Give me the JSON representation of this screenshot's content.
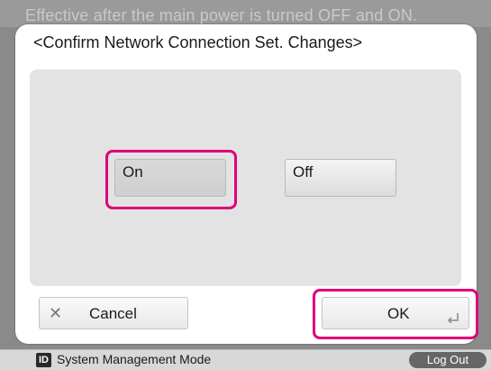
{
  "background": {
    "notice": "Effective after the main power is turned OFF and ON."
  },
  "dialog": {
    "title": "<Confirm Network Connection Set. Changes>",
    "options": {
      "on_label": "On",
      "off_label": "Off",
      "selected": "On"
    },
    "cancel": {
      "icon": "x-icon",
      "label": "Cancel"
    },
    "ok": {
      "label": "OK",
      "icon": "enter-return-icon"
    }
  },
  "status_bar": {
    "badge": "ID",
    "mode_label": "System Management Mode",
    "logout_label": "Log Out"
  },
  "colors": {
    "highlight": "#e0007a",
    "panel": "#e3e3e3"
  }
}
